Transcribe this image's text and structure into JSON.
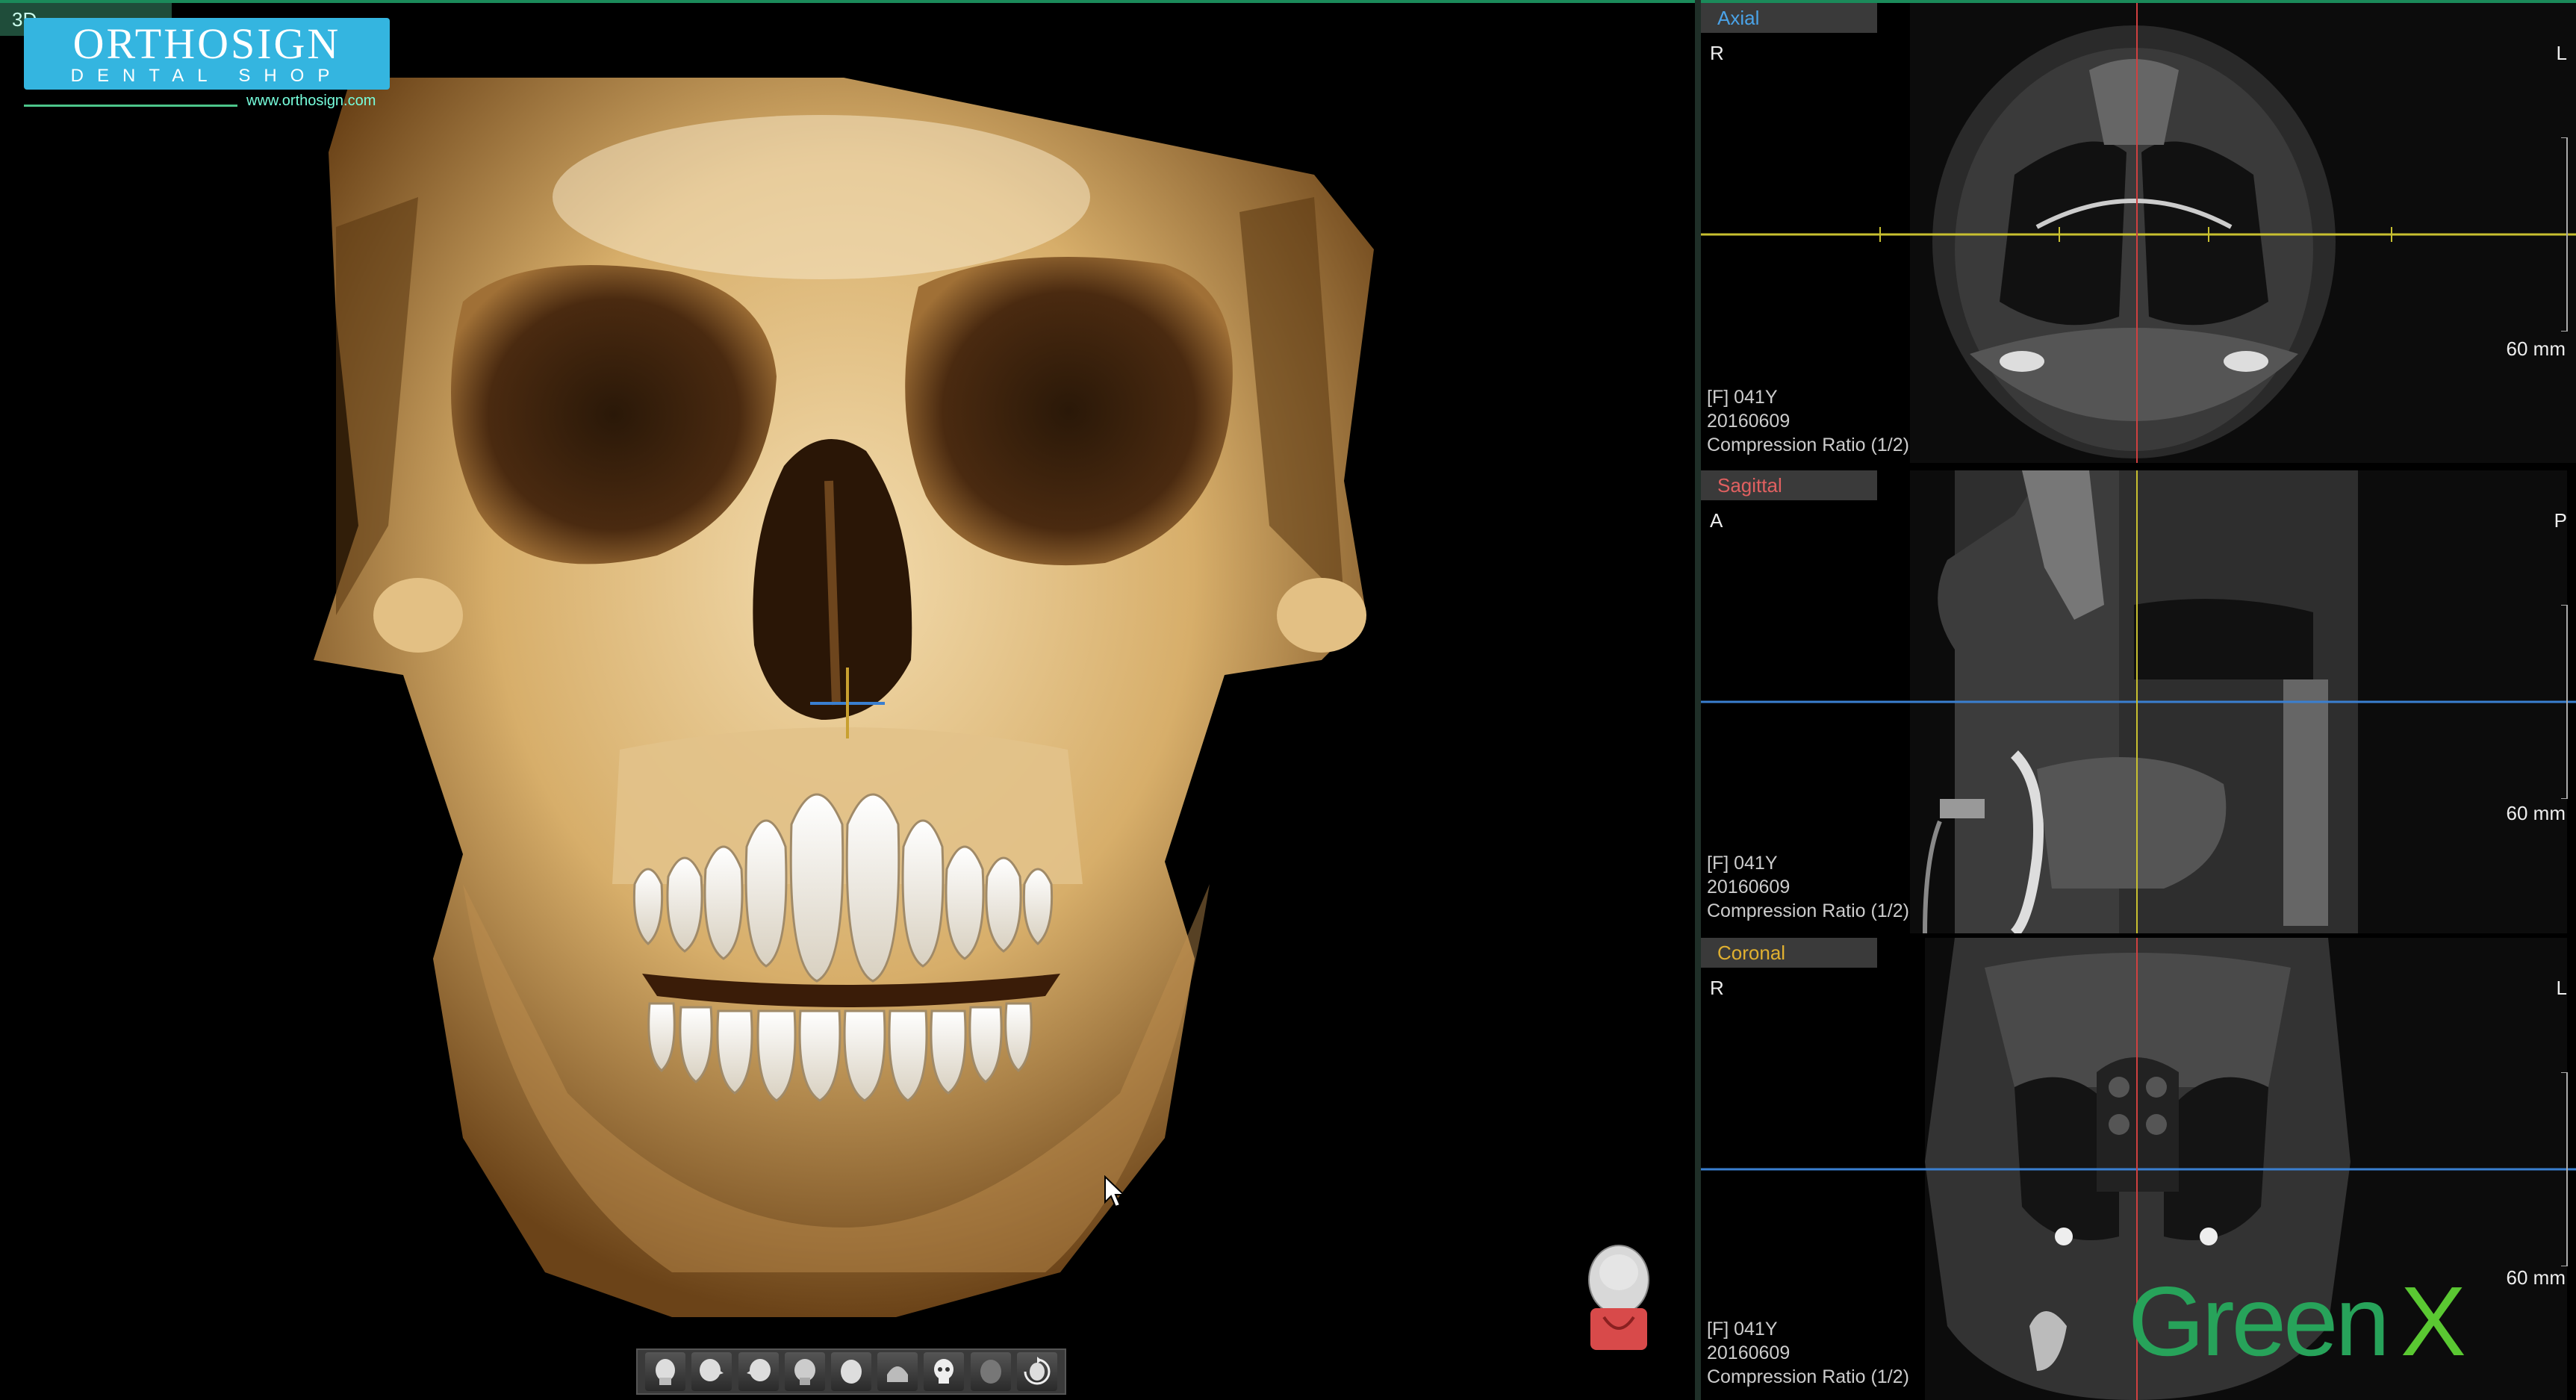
{
  "viewport_3d": {
    "tab_label": "3D",
    "brand": {
      "name": "ORTHOSIGN",
      "subtitle": "DENTAL SHOP",
      "url": "www.orthosign.com"
    },
    "toolbar": {
      "buttons": [
        {
          "icon": "head-front-icon"
        },
        {
          "icon": "head-right-icon"
        },
        {
          "icon": "head-left-icon"
        },
        {
          "icon": "head-back-icon"
        },
        {
          "icon": "head-top-icon"
        },
        {
          "icon": "head-bottom-icon"
        },
        {
          "icon": "skull-icon"
        },
        {
          "icon": "skin-icon"
        },
        {
          "icon": "rotate-icon"
        }
      ]
    }
  },
  "panels": {
    "axial": {
      "title": "Axial",
      "title_color": "#4aa3e8",
      "orient_left": "R",
      "orient_right": "L",
      "scale": "60 mm",
      "patient": "[F] 041Y",
      "date": "20160609",
      "compression": "Compression Ratio (1/2)"
    },
    "sagittal": {
      "title": "Sagittal",
      "title_color": "#e06060",
      "orient_left": "A",
      "orient_right": "P",
      "scale": "60 mm",
      "patient": "[F] 041Y",
      "date": "20160609",
      "compression": "Compression Ratio (1/2)"
    },
    "coronal": {
      "title": "Coronal",
      "title_color": "#e0b030",
      "orient_left": "R",
      "orient_right": "L",
      "scale": "60 mm",
      "patient": "[F] 041Y",
      "date": "20160609",
      "compression": "Compression Ratio (1/2)"
    }
  },
  "brand_watermark": {
    "text": "Green",
    "x_text": "X"
  },
  "colors": {
    "accent": "#1b8a5a",
    "crosshair_blue": "#3a7fd0",
    "crosshair_yellow": "#c8c030",
    "crosshair_red": "#d04040",
    "bone": "#e8c890"
  }
}
